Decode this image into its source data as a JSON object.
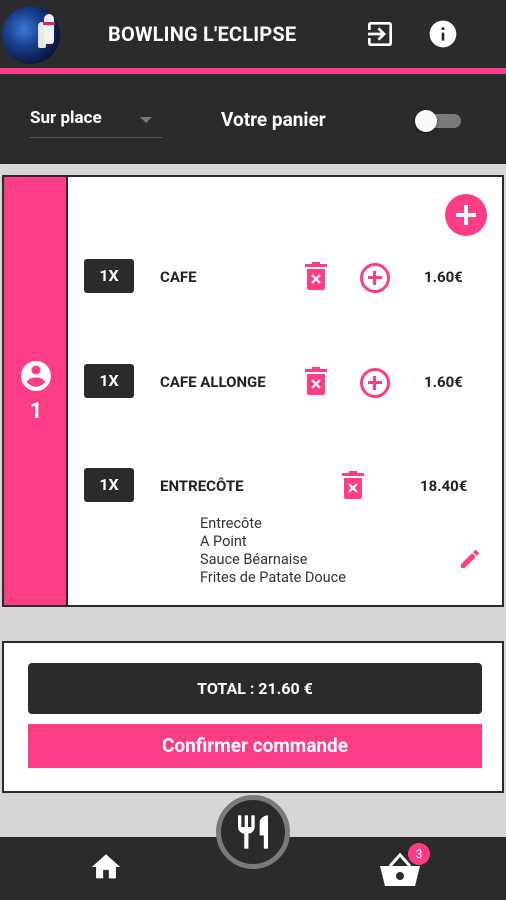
{
  "header": {
    "title": "BOWLING L'ECLIPSE",
    "icons": [
      "logout-icon",
      "info-icon"
    ]
  },
  "subbar": {
    "mode_selected": "Sur place",
    "panier_label": "Votre panier",
    "panier_toggle_on": false
  },
  "order": {
    "guest_number": "1",
    "items": [
      {
        "qty": "1X",
        "name": "CAFE",
        "price": "1.60€",
        "has_add": true
      },
      {
        "qty": "1X",
        "name": "CAFE ALLONGE",
        "price": "1.60€",
        "has_add": true
      },
      {
        "qty": "1X",
        "name": "ENTRECÔTE",
        "price": "18.40€",
        "has_add": false,
        "details": [
          "Entrecôte",
          "A Point",
          "Sauce Béarnaise",
          "Frites de Patate Douce"
        ]
      }
    ]
  },
  "summary": {
    "total_label": "TOTAL : 21.60 €",
    "confirm_label": "Confirmer commande"
  },
  "nav": {
    "cart_badge": "3"
  },
  "colors": {
    "accent": "#ff3d86",
    "dark": "#2b2b2b"
  }
}
